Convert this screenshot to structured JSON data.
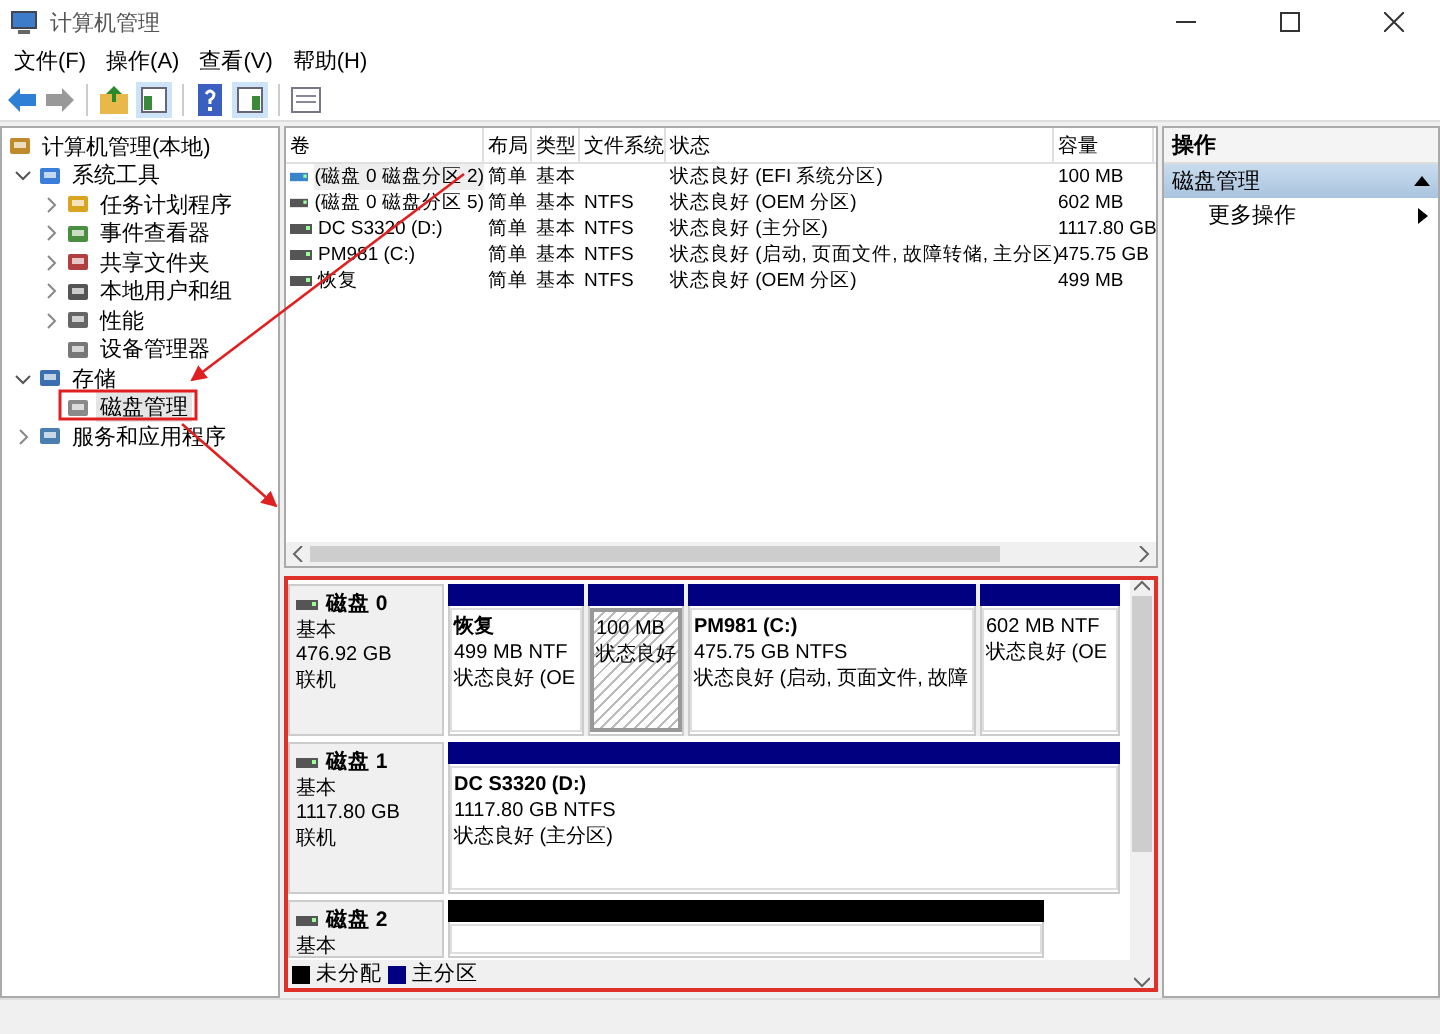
{
  "window": {
    "title": "计算机管理"
  },
  "menu": [
    "文件(F)",
    "操作(A)",
    "查看(V)",
    "帮助(H)"
  ],
  "tree": [
    {
      "label": "计算机管理(本地)",
      "selected": false,
      "children": [
        {
          "label": "系统工具",
          "expanded": true,
          "selected": false,
          "children": [
            {
              "label": "任务计划程序",
              "expanded": false,
              "selected": false
            },
            {
              "label": "事件查看器",
              "expanded": false,
              "selected": false
            },
            {
              "label": "共享文件夹",
              "expanded": false,
              "selected": false
            },
            {
              "label": "本地用户和组",
              "expanded": false,
              "selected": false
            },
            {
              "label": "性能",
              "expanded": false,
              "selected": false
            },
            {
              "label": "设备管理器",
              "selected": false
            }
          ]
        },
        {
          "label": "存储",
          "expanded": true,
          "selected": false,
          "children": [
            {
              "label": "磁盘管理",
              "selected": true
            }
          ]
        },
        {
          "label": "服务和应用程序",
          "expanded": false,
          "selected": false
        }
      ]
    }
  ],
  "volumes": {
    "columns": [
      "卷",
      "布局",
      "类型",
      "文件系统",
      "状态",
      "容量"
    ],
    "rows": [
      {
        "name": "(磁盘 0 磁盘分区 2)",
        "layout": "简单",
        "type": "基本",
        "status": "状态良好 (EFI 系统分区)",
        "capacity": "100 MB",
        "selected": true
      },
      {
        "name": "(磁盘 0 磁盘分区 5)",
        "layout": "简单",
        "type": "基本",
        "filesystem": "NTFS",
        "status": "状态良好 (OEM 分区)",
        "capacity": "602 MB",
        "selected": false
      },
      {
        "name": "DC S3320 (D:)",
        "layout": "简单",
        "type": "基本",
        "filesystem": "NTFS",
        "status": "状态良好 (主分区)",
        "capacity": "1117.80 GB",
        "selected": false
      },
      {
        "name": "PM981 (C:)",
        "layout": "简单",
        "type": "基本",
        "filesystem": "NTFS",
        "status": "状态良好 (启动, 页面文件, 故障转储, 主分区)",
        "capacity": "475.75 GB",
        "selected": false
      },
      {
        "name": "恢复",
        "layout": "简单",
        "type": "基本",
        "filesystem": "NTFS",
        "status": "状态良好 (OEM 分区)",
        "capacity": "499 MB",
        "selected": false
      }
    ]
  },
  "disks": [
    {
      "name": "磁盘 0",
      "type": "基本",
      "size": "476.92 GB",
      "status": "联机",
      "partitions": [
        {
          "kind": "primary",
          "selected": false,
          "name": "恢复",
          "size": "499 MB NTF",
          "status": "状态良好 (OE"
        },
        {
          "kind": "primary",
          "selected": true,
          "size": "100 MB",
          "status": "状态良好"
        },
        {
          "kind": "primary",
          "selected": false,
          "name": "PM981  (C:)",
          "size": "475.75 GB NTFS",
          "status": "状态良好 (启动, 页面文件, 故障"
        },
        {
          "kind": "primary",
          "selected": false,
          "size": "602 MB NTF",
          "status": "状态良好 (OE"
        }
      ]
    },
    {
      "name": "磁盘 1",
      "type": "基本",
      "size": "1117.80 GB",
      "status": "联机",
      "partitions": [
        {
          "kind": "primary",
          "selected": false,
          "name": "DC S3320  (D:)",
          "size": "1117.80 GB NTFS",
          "status": "状态良好 (主分区)"
        }
      ]
    },
    {
      "name": "磁盘 2",
      "type": "基本",
      "partitions": [
        {
          "kind": "unallocated",
          "selected": false
        }
      ]
    }
  ],
  "legend": [
    {
      "label": "未分配",
      "color": "#000000"
    },
    {
      "label": "主分区",
      "color": "#000080"
    }
  ],
  "actions": {
    "title": "操作",
    "section": {
      "label": "磁盘管理",
      "expanded": true
    },
    "items": [
      "更多操作"
    ]
  }
}
